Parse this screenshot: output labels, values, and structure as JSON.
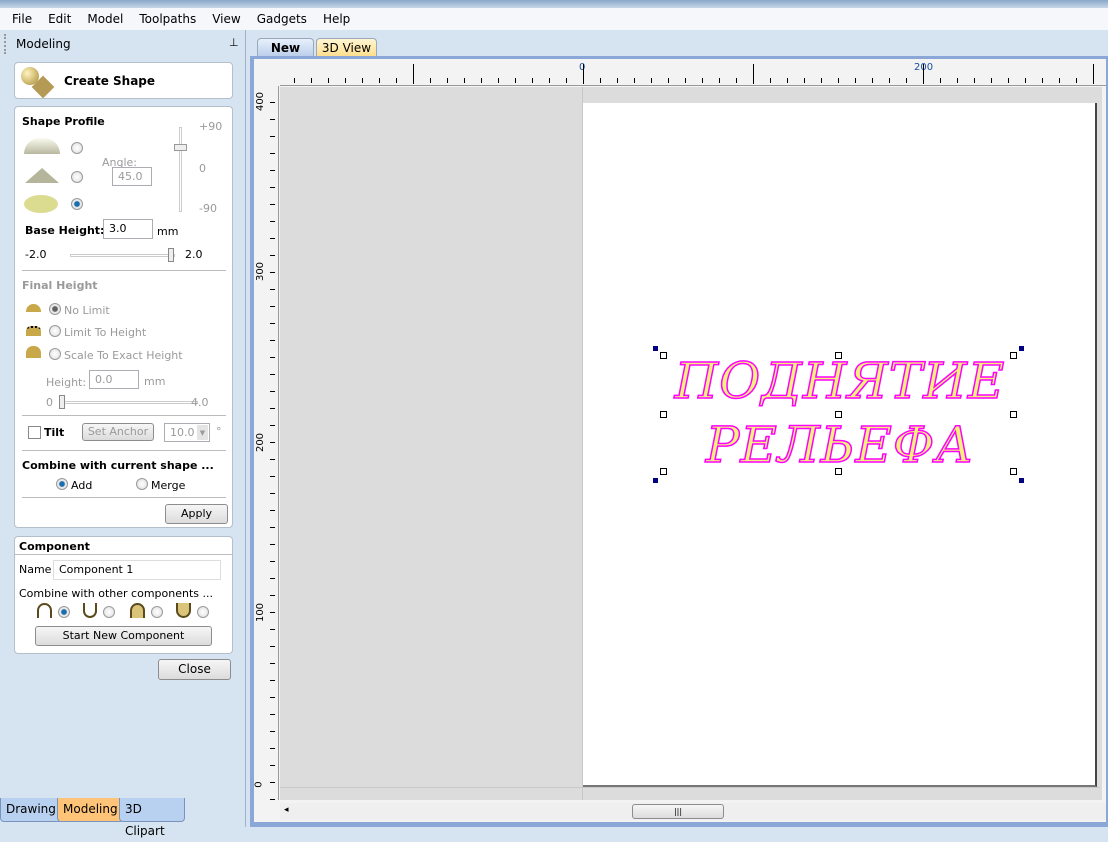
{
  "menu": [
    "File",
    "Edit",
    "Model",
    "Toolpaths",
    "View",
    "Gadgets",
    "Help"
  ],
  "panel": {
    "title": "Modeling",
    "create_shape": "Create Shape",
    "shape_profile": {
      "title": "Shape Profile",
      "angle_label": "Angle:",
      "angle_value": "45.0",
      "angle_scale": [
        "+90",
        "0",
        "-90"
      ],
      "selected_profile": "flat",
      "base_height_label": "Base Height:",
      "base_height_value": "3.0",
      "unit": "mm",
      "slider_min": "-2.0",
      "slider_max": "2.0"
    },
    "final_height": {
      "title": "Final Height",
      "options": [
        "No Limit",
        "Limit To Height",
        "Scale To Exact Height"
      ],
      "selected": "No Limit",
      "height_label": "Height:",
      "height_value": "0.0",
      "unit": "mm",
      "slider_min": "0",
      "slider_max": "4.0"
    },
    "tilt": {
      "label": "Tilt",
      "checked": false,
      "set_anchor": "Set Anchor",
      "angle_value": "10.0",
      "degree": "°"
    },
    "combine": {
      "title": "Combine with current shape ...",
      "options": [
        "Add",
        "Merge"
      ],
      "selected": "Add"
    },
    "apply": "Apply",
    "component": {
      "title": "Component",
      "name_label": "Name",
      "name_value": "Component 1",
      "combine_label": "Combine with other components ...",
      "start_new": "Start New Component"
    },
    "close": "Close"
  },
  "bottom_tabs": [
    "Drawing",
    "Modeling",
    "3D Clipart"
  ],
  "active_bottom_tab": "Modeling",
  "view_tabs": [
    "New",
    "3D View"
  ],
  "active_view_tab": "New",
  "ruler": {
    "top_labels": [
      "0",
      "200"
    ],
    "left_labels": [
      "400",
      "300",
      "200",
      "100",
      "0"
    ]
  },
  "canvas_text": {
    "line1": "ПОДНЯТИЕ",
    "line2": "РЕЛЬЕФА",
    "fill": "#f3f37a",
    "outline": "#ff00ff"
  }
}
